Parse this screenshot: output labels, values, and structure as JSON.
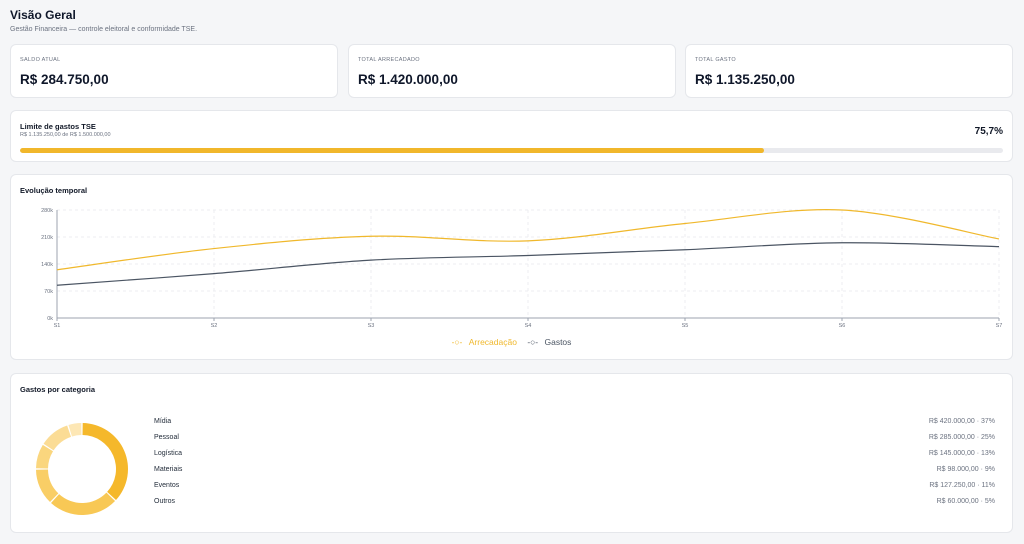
{
  "header": {
    "title": "Visão Geral",
    "subtitle": "Gestão Financeira — controle eleitoral e conformidade TSE."
  },
  "kpis": [
    {
      "label": "SALDO ATUAL",
      "value": "R$ 284.750,00"
    },
    {
      "label": "TOTAL ARRECADADO",
      "value": "R$ 1.420.000,00"
    },
    {
      "label": "TOTAL GASTO",
      "value": "R$ 1.135.250,00"
    }
  ],
  "limit": {
    "title": "Limite de gastos TSE",
    "subtitle": "R$ 1.135.250,00 de R$ 1.500.000,00",
    "percent_label": "75,7%",
    "fraction": 0.757,
    "color": "#f1b72b"
  },
  "chart_data": {
    "type": "line",
    "title": "Evolução temporal",
    "x": [
      "S1",
      "S2",
      "S3",
      "S4",
      "S5",
      "S6",
      "S7"
    ],
    "y_ticks": [
      "0k",
      "70k",
      "140k",
      "210k",
      "280k"
    ],
    "ylim": [
      0,
      280000
    ],
    "grid": true,
    "legend_position": "bottom",
    "series": [
      {
        "name": "Arrecadação",
        "color": "#f0b82c",
        "values": [
          125000,
          180000,
          212000,
          200000,
          245000,
          280000,
          205000
        ]
      },
      {
        "name": "Gastos",
        "color": "#4b5563",
        "values": [
          85000,
          115000,
          150000,
          162000,
          177000,
          195000,
          185000
        ]
      }
    ]
  },
  "categories": {
    "title": "Gastos por categoria",
    "items": [
      {
        "name": "Mídia",
        "value": "R$ 420.000,00 · 37%",
        "share": 37,
        "color": "#f5b82b"
      },
      {
        "name": "Pessoal",
        "value": "R$ 285.000,00 · 25%",
        "share": 25,
        "color": "#f8c855"
      },
      {
        "name": "Logística",
        "value": "R$ 145.000,00 · 13%",
        "share": 13,
        "color": "#f9ce66"
      },
      {
        "name": "Materiais",
        "value": "R$ 98.000,00 · 9%",
        "share": 9,
        "color": "#fad67e"
      },
      {
        "name": "Eventos",
        "value": "R$ 127.250,00 · 11%",
        "share": 11,
        "color": "#fbdc95"
      },
      {
        "name": "Outros",
        "value": "R$ 60.000,00 · 5%",
        "share": 5,
        "color": "#fde7b5"
      }
    ]
  }
}
